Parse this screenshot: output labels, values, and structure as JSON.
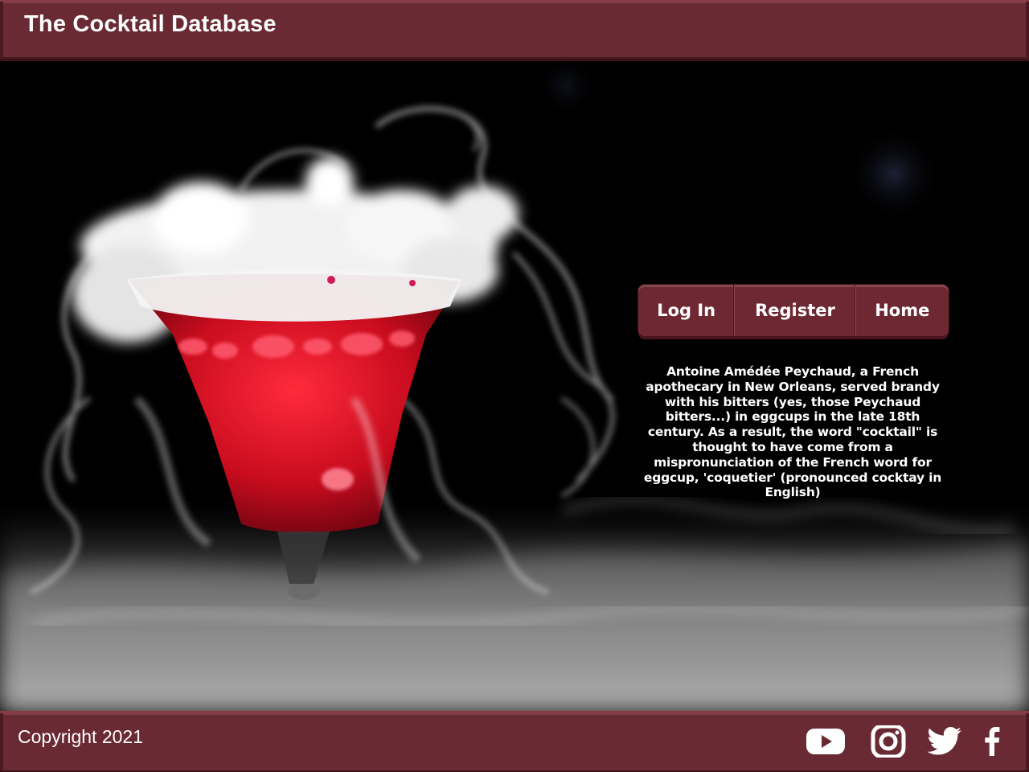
{
  "header": {
    "title": "The Cocktail Database"
  },
  "nav": {
    "login_label": "Log In",
    "register_label": "Register",
    "home_label": "Home"
  },
  "fact": {
    "text": "Antoine Amédée Peychaud, a French apothecary in New Orleans, served brandy with his bitters (yes, those Peychaud bitters...) in eggcups in the late 18th century. As a result, the word \"cocktail\" is thought to have come from a mispronunciation of the French word for eggcup, 'coquetier' (pronounced cocktay in English)"
  },
  "footer": {
    "copyright": "Copyright 2021",
    "social_icons": [
      "youtube-icon",
      "instagram-icon",
      "twitter-icon",
      "facebook-icon"
    ]
  },
  "colors": {
    "brand": "#6a2a33",
    "brand_dark": "#3e1218",
    "background": "#000000",
    "text": "#ffffff"
  }
}
